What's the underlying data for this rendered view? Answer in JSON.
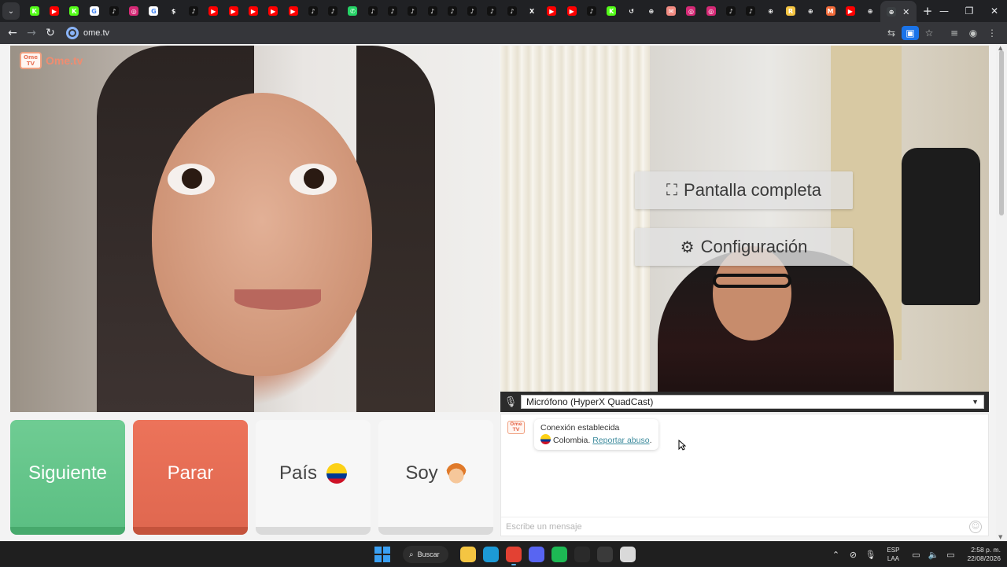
{
  "browser": {
    "url": "ome.tv",
    "tab_favicons": [
      {
        "name": "kick-icon",
        "color": "#53fc18",
        "glyph": "K"
      },
      {
        "name": "youtube-icon",
        "color": "#ff0000",
        "glyph": "▶"
      },
      {
        "name": "kick-icon",
        "color": "#53fc18",
        "glyph": "K"
      },
      {
        "name": "google-icon",
        "color": "#ffffff",
        "glyph": "G"
      },
      {
        "name": "tiktok-icon",
        "color": "#111111",
        "glyph": "♪"
      },
      {
        "name": "instagram-icon",
        "color": "#d62976",
        "glyph": "◎"
      },
      {
        "name": "google-icon",
        "color": "#ffffff",
        "glyph": "G"
      },
      {
        "name": "dollar-icon",
        "color": "#202124",
        "glyph": "$"
      },
      {
        "name": "tiktok-icon",
        "color": "#111111",
        "glyph": "♪"
      },
      {
        "name": "youtube-icon",
        "color": "#ff0000",
        "glyph": "▶"
      },
      {
        "name": "youtube-icon",
        "color": "#ff0000",
        "glyph": "▶"
      },
      {
        "name": "youtube-icon",
        "color": "#ff0000",
        "glyph": "▶"
      },
      {
        "name": "youtube-icon",
        "color": "#ff0000",
        "glyph": "▶"
      },
      {
        "name": "youtube-icon",
        "color": "#ff0000",
        "glyph": "▶"
      },
      {
        "name": "tiktok-icon",
        "color": "#111111",
        "glyph": "♪"
      },
      {
        "name": "tiktok-icon",
        "color": "#111111",
        "glyph": "♪"
      },
      {
        "name": "whatsapp-icon",
        "color": "#25d366",
        "glyph": "✆"
      },
      {
        "name": "tiktok-icon",
        "color": "#111111",
        "glyph": "♪"
      },
      {
        "name": "tiktok-icon",
        "color": "#111111",
        "glyph": "♪"
      },
      {
        "name": "tiktok-icon",
        "color": "#111111",
        "glyph": "♪"
      },
      {
        "name": "tiktok-icon",
        "color": "#111111",
        "glyph": "♪"
      },
      {
        "name": "tiktok-icon",
        "color": "#111111",
        "glyph": "♪"
      },
      {
        "name": "tiktok-icon",
        "color": "#111111",
        "glyph": "♪"
      },
      {
        "name": "tiktok-icon",
        "color": "#111111",
        "glyph": "♪"
      },
      {
        "name": "tiktok-icon",
        "color": "#111111",
        "glyph": "♪"
      },
      {
        "name": "x-icon",
        "color": "#202124",
        "glyph": "X"
      },
      {
        "name": "youtube-icon",
        "color": "#ff0000",
        "glyph": "▶"
      },
      {
        "name": "youtube-icon",
        "color": "#ff0000",
        "glyph": "▶"
      },
      {
        "name": "tiktok-icon",
        "color": "#111111",
        "glyph": "♪"
      },
      {
        "name": "kick-icon",
        "color": "#53fc18",
        "glyph": "K"
      },
      {
        "name": "history-icon",
        "color": "#202124",
        "glyph": "↺"
      },
      {
        "name": "globe-icon",
        "color": "#202124",
        "glyph": "⊕"
      },
      {
        "name": "mail-icon",
        "color": "#f28b82",
        "glyph": "✉"
      },
      {
        "name": "instagram-icon",
        "color": "#d62976",
        "glyph": "◎"
      },
      {
        "name": "instagram-icon",
        "color": "#d62976",
        "glyph": "◎"
      },
      {
        "name": "tiktok-icon",
        "color": "#111111",
        "glyph": "♪"
      },
      {
        "name": "tiktok-icon",
        "color": "#111111",
        "glyph": "♪"
      },
      {
        "name": "globe-icon",
        "color": "#202124",
        "glyph": "⊕"
      },
      {
        "name": "app-r-icon",
        "color": "#f5c542",
        "glyph": "R"
      },
      {
        "name": "globe-icon",
        "color": "#202124",
        "glyph": "⊕"
      },
      {
        "name": "app-m-icon",
        "color": "#f26b3a",
        "glyph": "M"
      },
      {
        "name": "youtube-icon",
        "color": "#ff0000",
        "glyph": "▶"
      },
      {
        "name": "globe-icon",
        "color": "#202124",
        "glyph": "⊕"
      }
    ]
  },
  "site": {
    "logo_badge": "Ome TV",
    "logo_text": "Ome.tv"
  },
  "overlay": {
    "fullscreen_label": "Pantalla completa",
    "settings_label": "Configuración"
  },
  "mic": {
    "selected": "Micrófono (HyperX QuadCast)"
  },
  "controls": {
    "next_label": "Siguiente",
    "stop_label": "Parar",
    "country_label": "País",
    "gender_label": "Soy"
  },
  "chat": {
    "status": "Conexión establecida",
    "country": "Colombia.",
    "report_link": "Reportar abuso",
    "report_suffix": ".",
    "input_placeholder": "Escribe un mensaje"
  },
  "taskbar": {
    "search_label": "Buscar",
    "apps": [
      {
        "name": "file-explorer-icon",
        "color": "#f4c542"
      },
      {
        "name": "edge-icon",
        "color": "#1c9ad6"
      },
      {
        "name": "chrome-icon",
        "color": "#e34133",
        "active": true
      },
      {
        "name": "discord-icon",
        "color": "#5865f2"
      },
      {
        "name": "spotify-icon",
        "color": "#1db954"
      },
      {
        "name": "app-wave-icon",
        "color": "#2a2a2a"
      },
      {
        "name": "steam-icon",
        "color": "#3a3a3a"
      },
      {
        "name": "app-box-icon",
        "color": "#d9d9d9"
      }
    ],
    "lang_top": "ESP",
    "lang_bottom": "LAA",
    "time": "2:58 p. m.",
    "date": "22/08/2026"
  }
}
